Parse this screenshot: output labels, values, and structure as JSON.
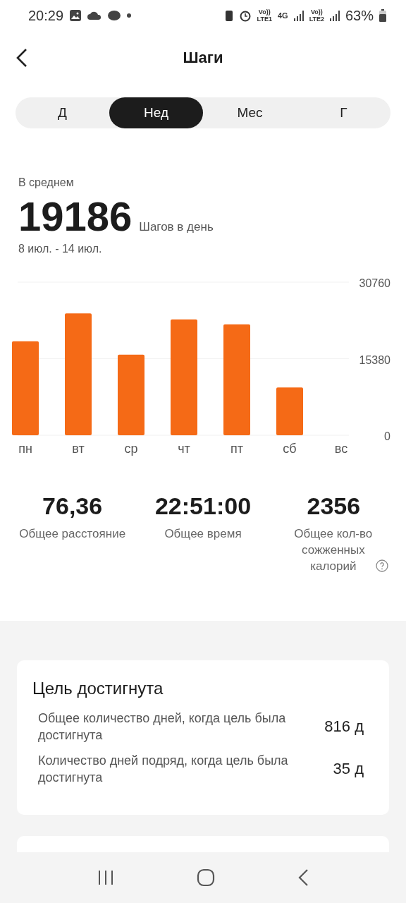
{
  "status_bar": {
    "time": "20:29",
    "network_labels": [
      "Vo))",
      "LTE1",
      "4G",
      "Vo))",
      "LTE2"
    ],
    "battery": "63%"
  },
  "header": {
    "title": "Шаги"
  },
  "tabs": [
    {
      "label": "Д",
      "selected": false
    },
    {
      "label": "Нед",
      "selected": true
    },
    {
      "label": "Мес",
      "selected": false
    },
    {
      "label": "Г",
      "selected": false
    }
  ],
  "summary": {
    "caption": "В среднем",
    "value": "19186",
    "unit": "Шагов в день",
    "range": "8 июл. - 14 июл."
  },
  "chart_data": {
    "type": "bar",
    "categories": [
      "пн",
      "вт",
      "ср",
      "чт",
      "пт",
      "сб",
      "вс"
    ],
    "series": [
      {
        "color": "#f56a16",
        "values": [
          18900,
          24500,
          16200,
          23300,
          22300,
          9600,
          null
        ]
      }
    ],
    "ylim": [
      0,
      30760
    ],
    "yticks": [
      0,
      15380,
      30760
    ]
  },
  "stats": [
    {
      "value": "76,36",
      "label": "Общее расстояние",
      "info": false
    },
    {
      "value": "22:51:00",
      "label": "Общее время",
      "info": false
    },
    {
      "value": "2356",
      "label": "Общее кол-во сожженных калорий",
      "info": true
    }
  ],
  "goal_card": {
    "title": "Цель достигнута",
    "rows": [
      {
        "label": "Общее количество дней, когда цель была достигнута",
        "value": "816 д"
      },
      {
        "label": "Количество дней подряд, когда цель была достигнута",
        "value": "35 д"
      }
    ]
  }
}
